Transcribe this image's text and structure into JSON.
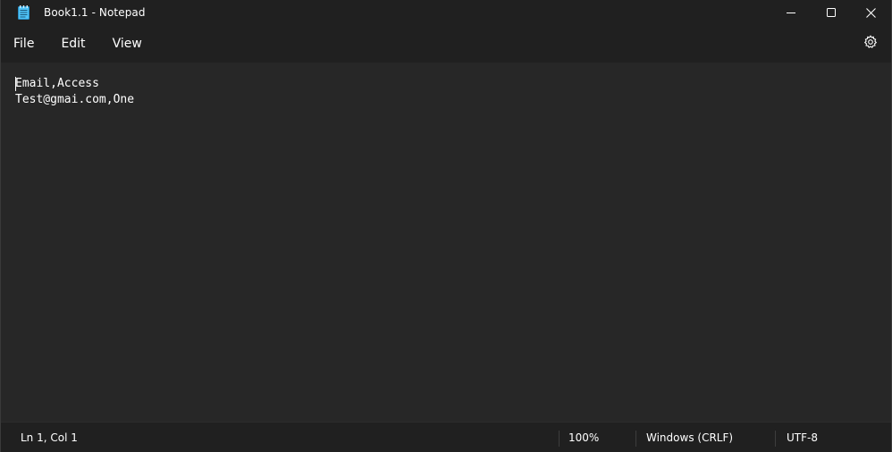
{
  "window": {
    "title": "Book1.1 - Notepad",
    "app_icon": "notepad-icon"
  },
  "caption": {
    "minimize_icon": "minimize-icon",
    "maximize_icon": "maximize-icon",
    "close_icon": "close-icon"
  },
  "menu": {
    "items": [
      {
        "label": "File"
      },
      {
        "label": "Edit"
      },
      {
        "label": "View"
      }
    ],
    "settings_icon": "gear-icon"
  },
  "editor": {
    "lines": [
      "Email,Access",
      "Test@gmai.com,One"
    ]
  },
  "status": {
    "position": "Ln 1, Col 1",
    "zoom": "100%",
    "line_ending": "Windows (CRLF)",
    "encoding": "UTF-8"
  },
  "colors": {
    "titlebar_bg": "#202020",
    "editor_bg": "#272727",
    "text": "#ffffff",
    "icon_accent": "#4fc3f7"
  }
}
